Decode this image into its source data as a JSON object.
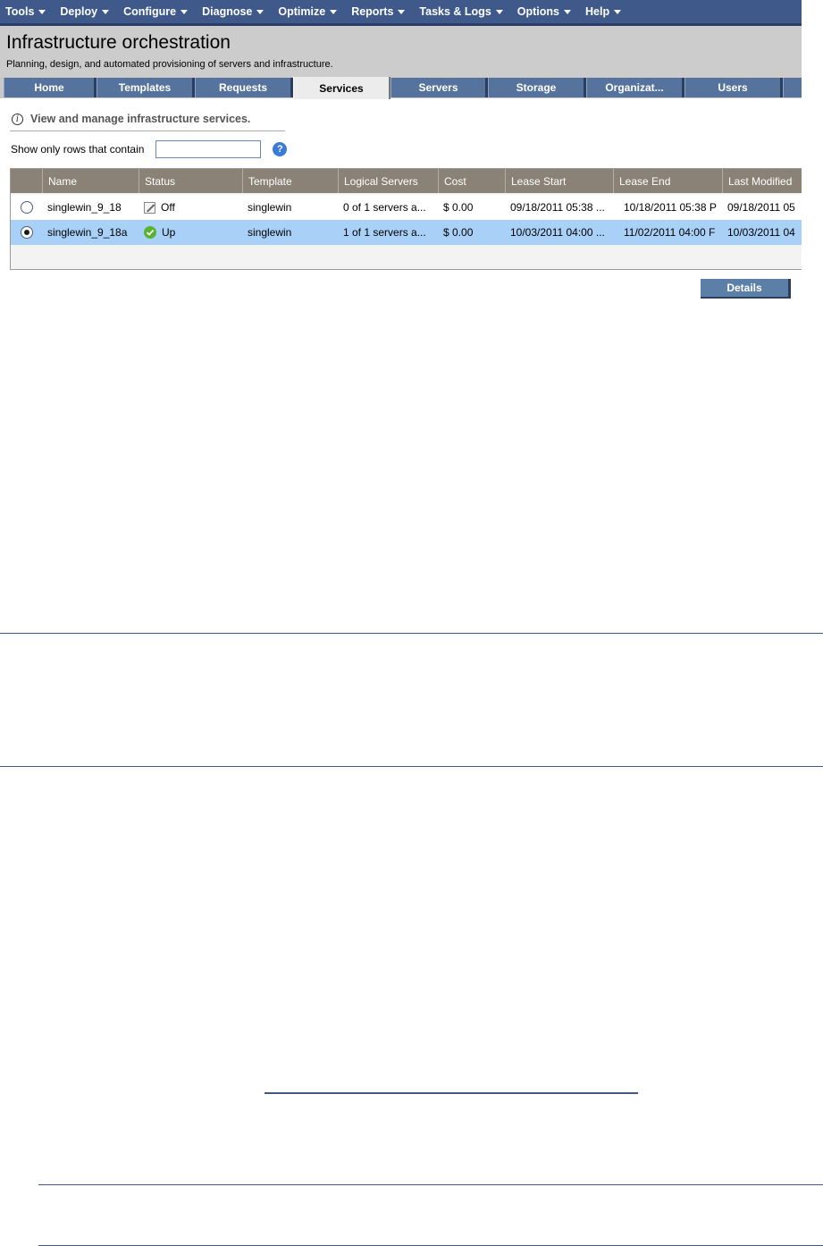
{
  "menubar": {
    "items": [
      {
        "label": "Tools"
      },
      {
        "label": "Deploy"
      },
      {
        "label": "Configure"
      },
      {
        "label": "Diagnose"
      },
      {
        "label": "Optimize"
      },
      {
        "label": "Reports"
      },
      {
        "label": "Tasks & Logs"
      },
      {
        "label": "Options"
      },
      {
        "label": "Help"
      }
    ]
  },
  "banner": {
    "title": "Infrastructure orchestration",
    "subtitle": "Planning, design, and automated provisioning of servers and infrastructure."
  },
  "tabs": [
    {
      "label": "Home"
    },
    {
      "label": "Templates"
    },
    {
      "label": "Requests"
    },
    {
      "label": "Services",
      "active": true
    },
    {
      "label": "Servers"
    },
    {
      "label": "Storage"
    },
    {
      "label": "Organizat..."
    },
    {
      "label": "Users"
    }
  ],
  "info": {
    "text": "View and manage infrastructure services.",
    "icon": "info-icon"
  },
  "filter": {
    "label": "Show only rows that contain",
    "value": "",
    "help_icon": "?"
  },
  "grid": {
    "columns": [
      "Name",
      "Status",
      "Template",
      "Logical Servers",
      "Cost",
      "Lease Start",
      "Lease End",
      "Last Modified"
    ],
    "rows": [
      {
        "selected": false,
        "name": "singlewin_9_18",
        "status": "Off",
        "status_icon": "off-icon",
        "template": "singlewin",
        "logical_servers": "0 of 1 servers a...",
        "cost": "$ 0.00",
        "lease_start": "09/18/2011 05:38 ...",
        "lease_end": "10/18/2011 05:38 P",
        "last_modified": "09/18/2011 05"
      },
      {
        "selected": true,
        "name": "singlewin_9_18a",
        "status": "Up",
        "status_icon": "up-check-icon",
        "template": "singlewin",
        "logical_servers": "1 of 1 servers a...",
        "cost": "$ 0.00",
        "lease_start": "10/03/2011 04:00 ...",
        "lease_end": "11/02/2011 04:00 F",
        "last_modified": "10/03/2011 04"
      }
    ]
  },
  "actions": {
    "details_label": "Details"
  },
  "colors": {
    "menubar": "#3f5a8a",
    "tab": "#55739c",
    "grid_header": "#8a8276",
    "selected_row": "#a9d0f7",
    "rule": "#3f5a8a"
  }
}
